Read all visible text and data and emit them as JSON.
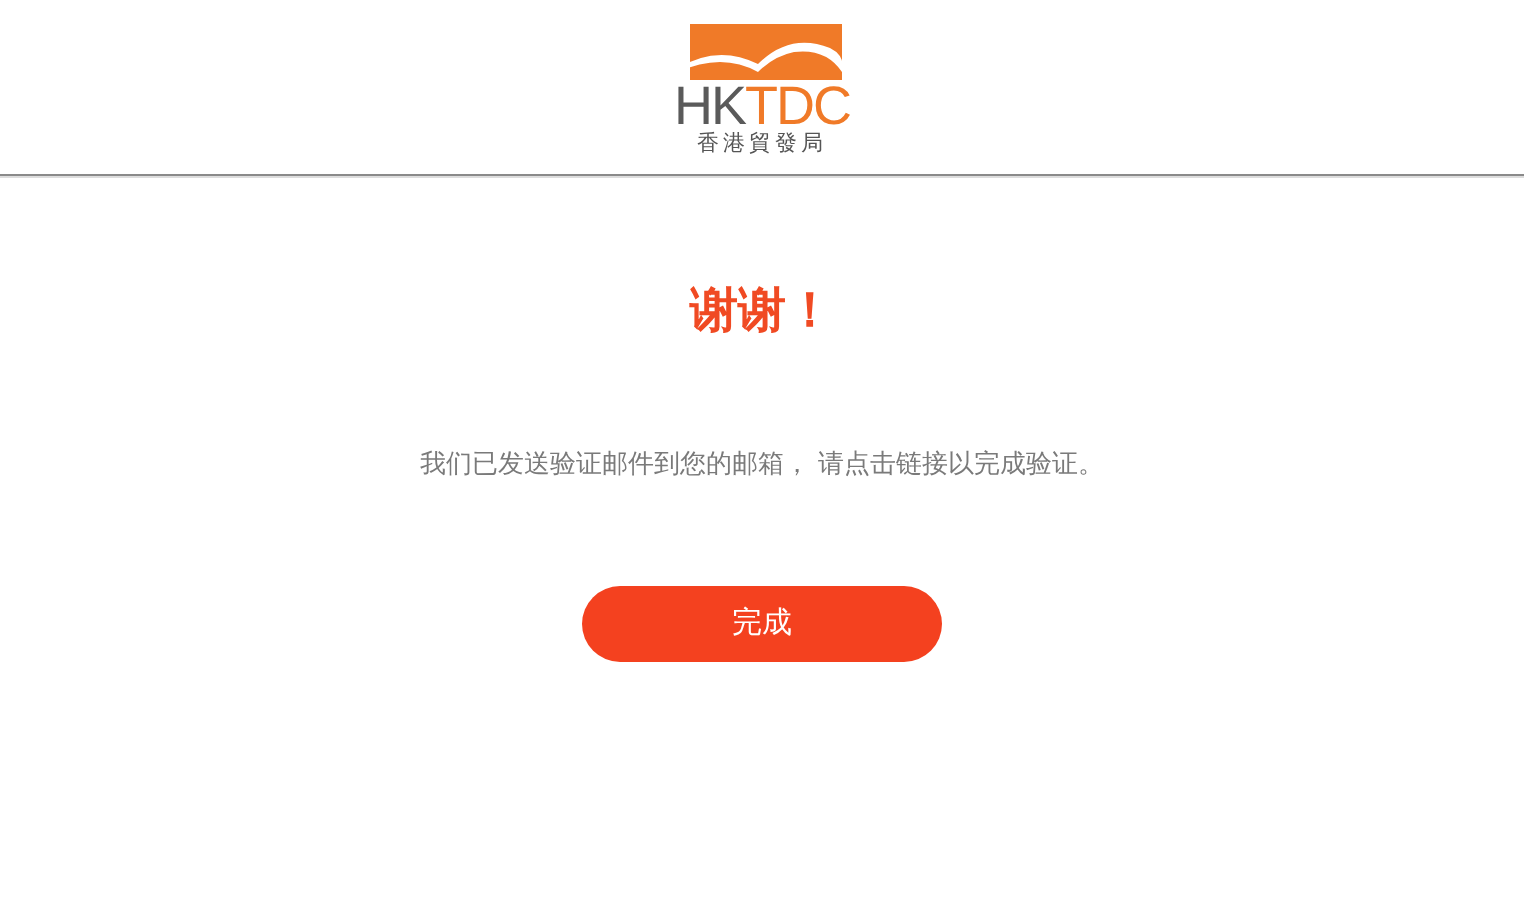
{
  "header": {
    "logo": {
      "mark_dark": "HK",
      "mark_light": "TDC",
      "subtitle": "香港貿發局"
    }
  },
  "title": "谢谢！",
  "message": "我们已发送验证邮件到您的邮箱， 请点击链接以完成验证。",
  "button": {
    "label": "完成"
  }
}
